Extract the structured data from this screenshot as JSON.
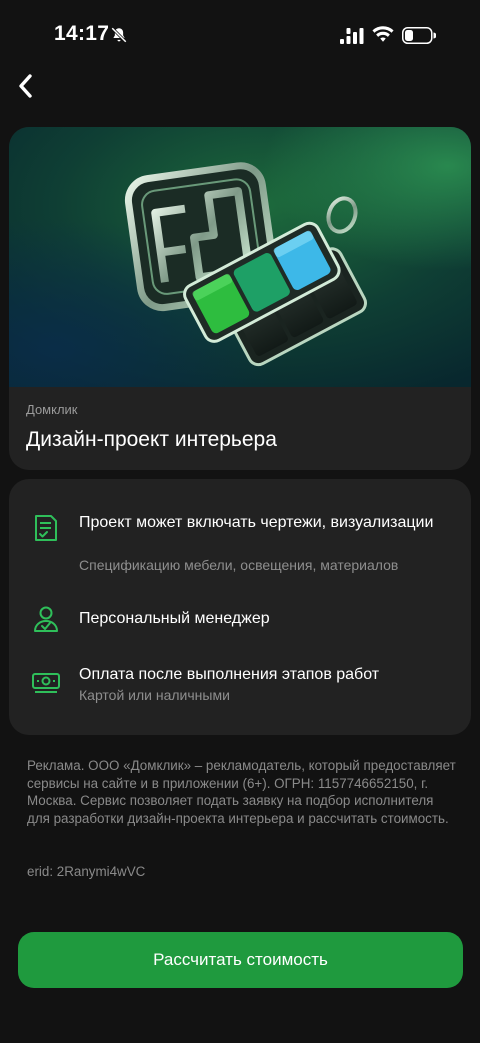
{
  "status_bar": {
    "time": "14:17",
    "icons": [
      "bell-off-icon",
      "signal-icon",
      "wifi-icon",
      "battery-icon"
    ]
  },
  "navigation": {
    "back_icon": "chevron-left-icon"
  },
  "hero": {
    "brand": "Домклик",
    "title": "Дизайн-проект интерьера"
  },
  "features": [
    {
      "icon": "blueprint-document-icon",
      "title": "Проект может включать чертежи, визуализации",
      "subtitle": "Спецификацию мебели, освещения, материалов"
    },
    {
      "icon": "manager-person-icon",
      "title": "Персональный менеджер",
      "subtitle": ""
    },
    {
      "icon": "cash-payment-icon",
      "title": "Оплата после выполнения этапов работ",
      "subtitle": "Картой или наличными"
    }
  ],
  "legal": {
    "text": "Реклама. ООО «Домклик» – рекламодатель, который предоставляет сервисы на сайте и в приложении (6+). ОГРН: 1157746652150, г. Москва. Сервис позволяет подать заявку на подбор исполнителя для разработки дизайн-проекта интерьера и рассчитать стоимость.",
    "erid": "erid: 2Ranymi4wVC"
  },
  "cta": {
    "label": "Рассчитать стоимость"
  },
  "colors": {
    "accent": "#1f9a3e",
    "icon_green": "#2fbf5a",
    "card_bg": "#222222",
    "page_bg": "#121212"
  }
}
